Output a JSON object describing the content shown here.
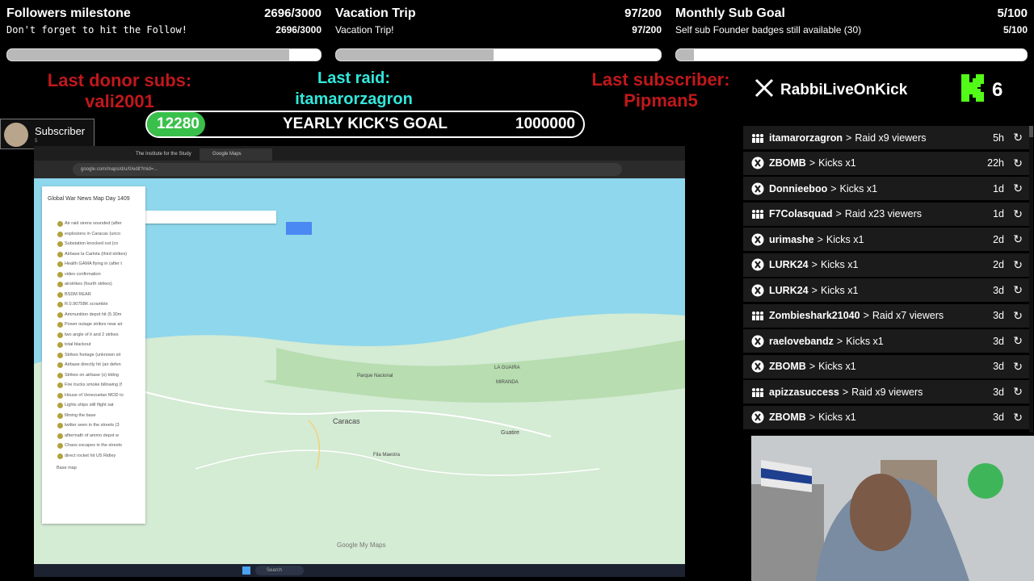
{
  "goals": [
    {
      "title": "Followers milestone",
      "subtitle": "Don't forget to hit the Follow!",
      "count": "2696/3000",
      "progress": 0.899
    },
    {
      "title": "Vacation Trip",
      "subtitle": "Vacation Trip!",
      "count": "97/200",
      "progress": 0.485
    },
    {
      "title": "Monthly Sub Goal",
      "subtitle": "Self sub Founder badges still available (30)",
      "count": "5/100",
      "progress": 0.05
    }
  ],
  "last_donor": {
    "label": "Last donor subs:",
    "name": "vali2001"
  },
  "last_raid": {
    "label": "Last raid:",
    "name": "itamarorzagron"
  },
  "last_sub": {
    "label": "Last subscriber:",
    "name": "Pipman5"
  },
  "yearly_goal": {
    "current": "12280",
    "label": "YEARLY KICK'S GOAL",
    "target": "1000000",
    "progress": 0.01228
  },
  "x_handle": "RabbiLiveOnKick",
  "kick_count": "6",
  "sub_badge": {
    "label": "Subscriber",
    "count": "5"
  },
  "events": [
    {
      "type": "raid",
      "name": "itamarorzagron",
      "action": "Raid x9 viewers",
      "ago": "5h"
    },
    {
      "type": "kick",
      "name": "ZBOMB",
      "action": "Kicks x1",
      "ago": "22h"
    },
    {
      "type": "kick",
      "name": "Donnieeboo",
      "action": "Kicks x1",
      "ago": "1d"
    },
    {
      "type": "raid",
      "name": "F7Colasquad",
      "action": "Raid x23 viewers",
      "ago": "1d"
    },
    {
      "type": "kick",
      "name": "urimashe",
      "action": "Kicks x1",
      "ago": "2d"
    },
    {
      "type": "kick",
      "name": "LURK24",
      "action": "Kicks x1",
      "ago": "2d"
    },
    {
      "type": "kick",
      "name": "LURK24",
      "action": "Kicks x1",
      "ago": "3d"
    },
    {
      "type": "raid",
      "name": "Zombieshark21040",
      "action": "Raid x7 viewers",
      "ago": "3d"
    },
    {
      "type": "kick",
      "name": "raelovebandz",
      "action": "Kicks x1",
      "ago": "3d"
    },
    {
      "type": "kick",
      "name": "ZBOMB",
      "action": "Kicks x1",
      "ago": "3d"
    },
    {
      "type": "raid",
      "name": "apizzasuccess",
      "action": "Raid x9 viewers",
      "ago": "3d"
    },
    {
      "type": "kick",
      "name": "ZBOMB",
      "action": "Kicks x1",
      "ago": "3d"
    }
  ],
  "screen": {
    "tabs": [
      "The Institute for the Study",
      "Google Maps"
    ],
    "map_title": "Global War News Map Day 1409",
    "map_labels": [
      "Caracas",
      "LA GUAIRA",
      "MIRANDA",
      "Guatire",
      "Parque Nacional",
      "Fila Maestra"
    ],
    "layer_items": [
      "Air raid sirens sounded (after",
      "explosions in Caracas (unco",
      "Substation knocked out (co",
      "Airbase la Carlota (third strikes)",
      "Health GAMA flying in (after t",
      "video confirmation",
      "airstrikes (fourth strikes)",
      "BSDM REAR",
      "R.0.9075BK scramble",
      "Ammunition depot hit (5.30m",
      "Power outage strikes near air",
      "two angle of it and 2 strikes",
      "total blackout",
      "Strikes footage (unknown sit",
      "Airbase directly hit (air defen",
      "Strikes on airbase (s) bldng",
      "Fire trucks smoke billowing (f",
      "House of Venezuelan MOD to",
      "Lights ships still flight sat",
      "filming the base",
      "twitter seen in the streets (3",
      "aftermath of ammo depot w",
      "Chaos escapes in the streets",
      "direct rocket hit US Ridley"
    ],
    "base_map_label": "Base map",
    "google_logo": "Google My Maps",
    "search_placeholder": "Search"
  },
  "colors": {
    "red": "#c0181b",
    "cyan": "#31e8dc",
    "kick_green": "#53fc18",
    "goal_green": "#39c04a"
  }
}
